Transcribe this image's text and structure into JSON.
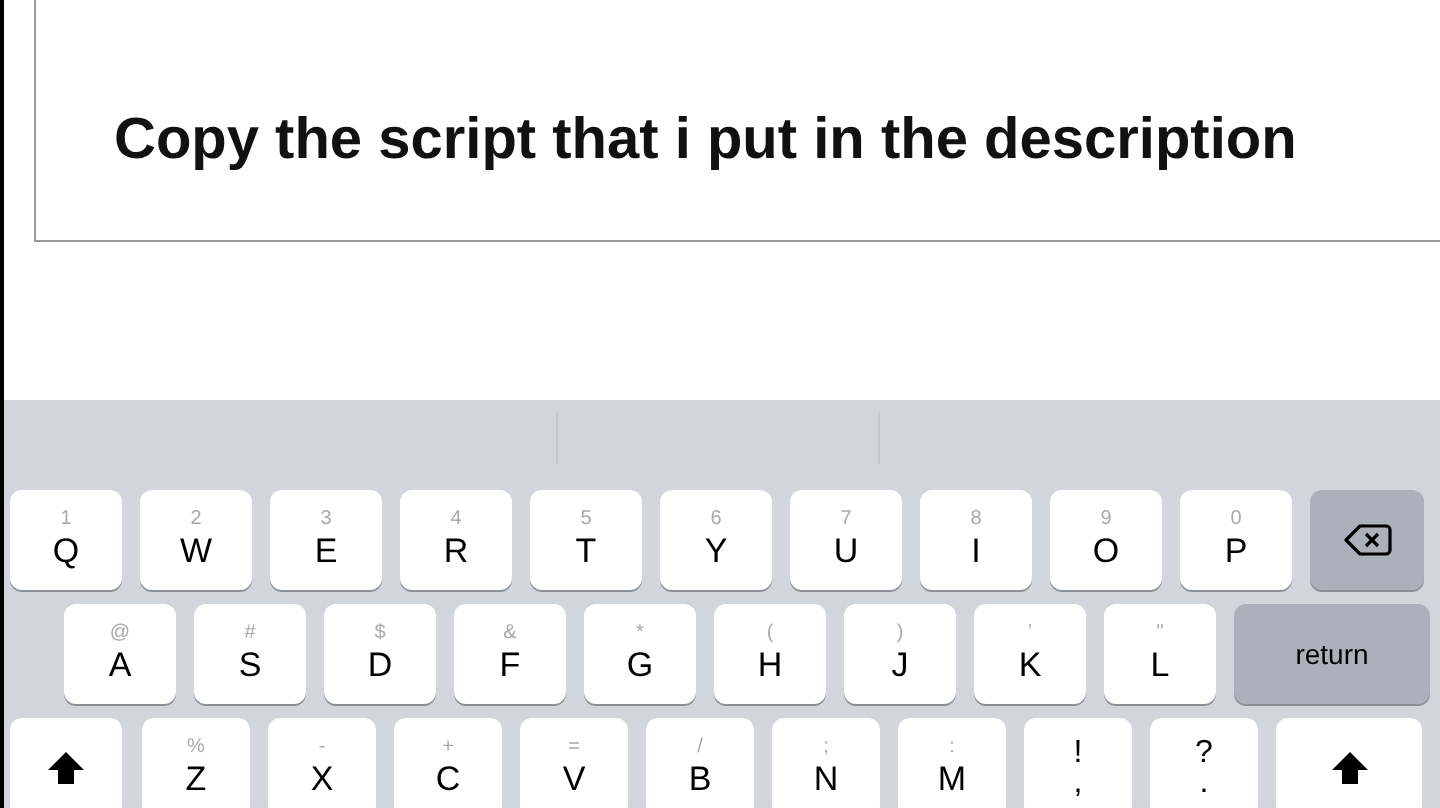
{
  "text_box": {
    "text": "Copy the script that i put in the description"
  },
  "keyboard": {
    "rows": [
      [
        {
          "kind": "letter",
          "hint": "1",
          "label": "Q"
        },
        {
          "kind": "letter",
          "hint": "2",
          "label": "W"
        },
        {
          "kind": "letter",
          "hint": "3",
          "label": "E"
        },
        {
          "kind": "letter",
          "hint": "4",
          "label": "R"
        },
        {
          "kind": "letter",
          "hint": "5",
          "label": "T"
        },
        {
          "kind": "letter",
          "hint": "6",
          "label": "Y"
        },
        {
          "kind": "letter",
          "hint": "7",
          "label": "U"
        },
        {
          "kind": "letter",
          "hint": "8",
          "label": "I"
        },
        {
          "kind": "letter",
          "hint": "9",
          "label": "O"
        },
        {
          "kind": "letter",
          "hint": "0",
          "label": "P"
        },
        {
          "kind": "backspace"
        }
      ],
      [
        {
          "kind": "letter",
          "hint": "@",
          "label": "A"
        },
        {
          "kind": "letter",
          "hint": "#",
          "label": "S"
        },
        {
          "kind": "letter",
          "hint": "$",
          "label": "D"
        },
        {
          "kind": "letter",
          "hint": "&",
          "label": "F"
        },
        {
          "kind": "letter",
          "hint": "*",
          "label": "G"
        },
        {
          "kind": "letter",
          "hint": "(",
          "label": "H"
        },
        {
          "kind": "letter",
          "hint": ")",
          "label": "J"
        },
        {
          "kind": "letter",
          "hint": "’",
          "label": "K"
        },
        {
          "kind": "letter",
          "hint": "\"",
          "label": "L"
        },
        {
          "kind": "return",
          "label": "return"
        }
      ],
      [
        {
          "kind": "shift"
        },
        {
          "kind": "letter",
          "hint": "%",
          "label": "Z"
        },
        {
          "kind": "letter",
          "hint": "-",
          "label": "X"
        },
        {
          "kind": "letter",
          "hint": "+",
          "label": "C"
        },
        {
          "kind": "letter",
          "hint": "=",
          "label": "V"
        },
        {
          "kind": "letter",
          "hint": "/",
          "label": "B"
        },
        {
          "kind": "letter",
          "hint": ";",
          "label": "N"
        },
        {
          "kind": "letter",
          "hint": ":",
          "label": "M"
        },
        {
          "kind": "punct",
          "hint": "!",
          "label": ","
        },
        {
          "kind": "punct",
          "hint": "?",
          "label": "."
        },
        {
          "kind": "shift"
        }
      ]
    ]
  }
}
